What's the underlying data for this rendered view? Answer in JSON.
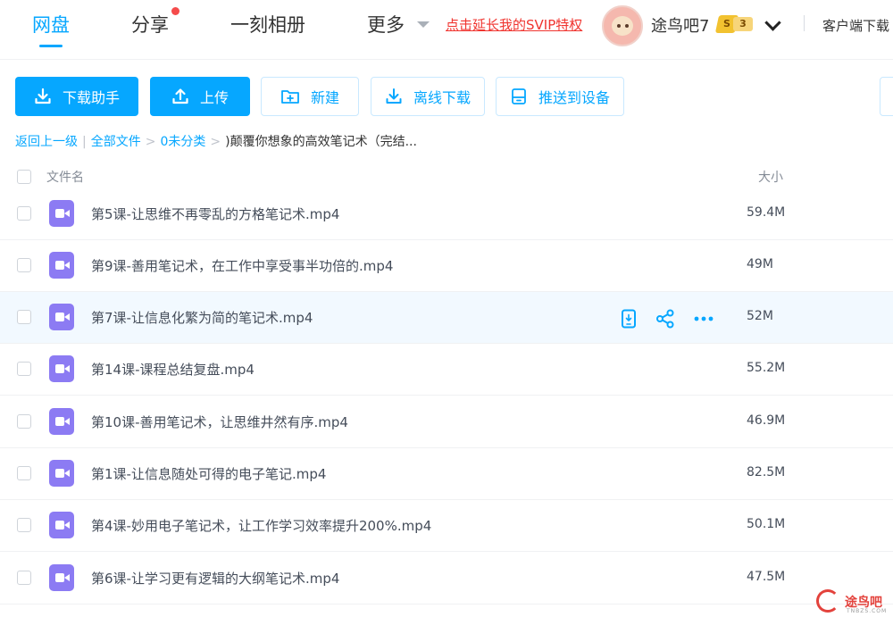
{
  "nav": {
    "tabs": [
      {
        "label": "网盘",
        "active": true
      },
      {
        "label": "分享"
      },
      {
        "label": "一刻相册"
      },
      {
        "label": "更多"
      }
    ],
    "svip_link": "点击延长我的SVIP特权",
    "username": "途鸟吧7",
    "badge_s": "S",
    "badge_level": "3",
    "client_download": "客户端下载"
  },
  "toolbar": {
    "download_helper": "下载助手",
    "upload": "上传",
    "new_folder": "新建",
    "offline_download": "离线下载",
    "push_to_device": "推送到设备"
  },
  "breadcrumb": {
    "back": "返回上一级",
    "all_files": "全部文件",
    "uncategorized": "0未分类",
    "current": ")颠覆你想象的高效笔记术（完结..."
  },
  "table": {
    "col_name": "文件名",
    "col_size": "大小",
    "rows": [
      {
        "name": "第5课-让思维不再零乱的方格笔记术.mp4",
        "size": "59.4M"
      },
      {
        "name": "第9课-善用笔记术，在工作中享受事半功倍的.mp4",
        "size": "49M"
      },
      {
        "name": "第7课-让信息化繁为简的笔记术.mp4",
        "size": "52M",
        "hover": true
      },
      {
        "name": "第14课-课程总结复盘.mp4",
        "size": "55.2M"
      },
      {
        "name": "第10课-善用笔记术，让思维井然有序.mp4",
        "size": "46.9M"
      },
      {
        "name": "第1课-让信息随处可得的电子笔记.mp4",
        "size": "82.5M"
      },
      {
        "name": "第4课-妙用电子笔记术，让工作学习效率提升200%.mp4",
        "size": "50.1M"
      },
      {
        "name": "第6课-让学习更有逻辑的大纲笔记术.mp4",
        "size": "47.5M"
      }
    ]
  },
  "watermark": {
    "text": "途鸟吧",
    "sub": "TNBZS.COM"
  },
  "colors": {
    "accent": "#06a7ff",
    "svip": "#f0342f",
    "video_icon": "#8c7bf3"
  }
}
